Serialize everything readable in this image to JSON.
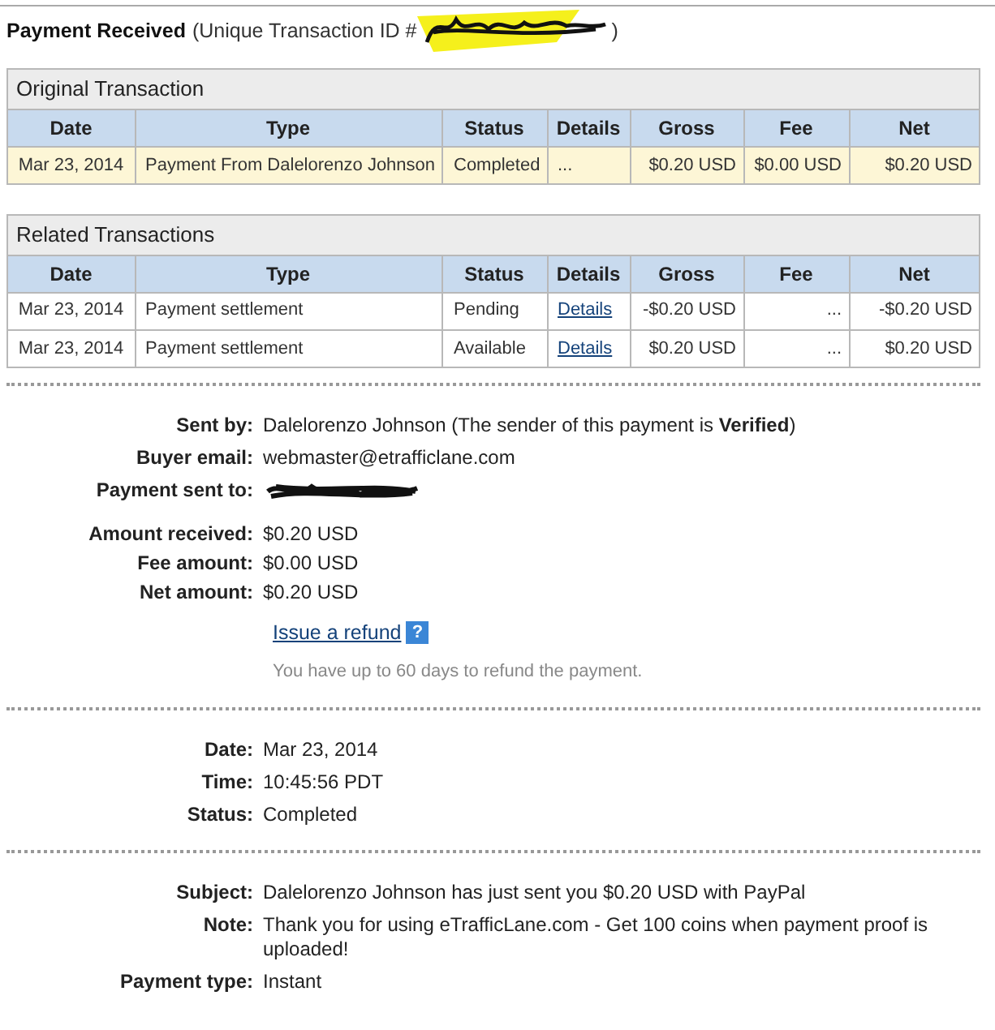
{
  "heading": {
    "title": "Payment Received",
    "id_label": "(Unique Transaction ID #",
    "id_close": ")"
  },
  "tables": [
    {
      "kind": "original",
      "title": "Original Transaction",
      "columns": [
        "Date",
        "Type",
        "Status",
        "Details",
        "Gross",
        "Fee",
        "Net"
      ],
      "rows": [
        {
          "date": "Mar 23, 2014",
          "type": "Payment From Dalelorenzo Johnson",
          "status": "Completed",
          "details": "...",
          "details_link": false,
          "gross": "$0.20 USD",
          "fee": "$0.00 USD",
          "net": "$0.20 USD"
        }
      ]
    },
    {
      "kind": "related",
      "title": "Related Transactions",
      "columns": [
        "Date",
        "Type",
        "Status",
        "Details",
        "Gross",
        "Fee",
        "Net"
      ],
      "rows": [
        {
          "date": "Mar 23, 2014",
          "type": "Payment settlement",
          "status": "Pending",
          "details": "Details",
          "details_link": true,
          "gross": "-$0.20 USD",
          "fee": "...",
          "net": "-$0.20 USD"
        },
        {
          "date": "Mar 23, 2014",
          "type": "Payment settlement",
          "status": "Available",
          "details": "Details",
          "details_link": true,
          "gross": "$0.20 USD",
          "fee": "...",
          "net": "$0.20 USD"
        }
      ]
    }
  ],
  "sections": [
    {
      "groups": [
        [
          {
            "label": "Sent by:",
            "value": "Dalelorenzo Johnson (The sender of this payment is **Verified**)"
          },
          {
            "label": "Buyer email:",
            "value": "webmaster@etrafficlane.com"
          },
          {
            "label": "Payment sent to:",
            "kind": "redacted"
          }
        ],
        [
          {
            "label": "Amount received:",
            "value": "$0.20 USD"
          },
          {
            "label": "Fee amount:",
            "value": "$0.00 USD"
          },
          {
            "label": "Net amount:",
            "value": "$0.20 USD"
          }
        ]
      ],
      "refund": {
        "link": "Issue a refund",
        "help": "?",
        "note": "You have up to 60 days to refund the payment."
      }
    },
    {
      "groups": [
        [
          {
            "label": "Date:",
            "value": "Mar 23, 2014"
          },
          {
            "label": "Time:",
            "value": "10:45:56 PDT"
          },
          {
            "label": "Status:",
            "value": "Completed"
          }
        ]
      ]
    },
    {
      "groups": [
        [
          {
            "label": "Subject:",
            "value": "Dalelorenzo Johnson has just sent you $0.20 USD with PayPal"
          },
          {
            "label": "Note:",
            "value": "Thank you for using eTrafficLane.com - Get 100 coins when payment proof is uploaded!"
          },
          {
            "label": "Payment type:",
            "value": "Instant"
          }
        ]
      ]
    }
  ]
}
